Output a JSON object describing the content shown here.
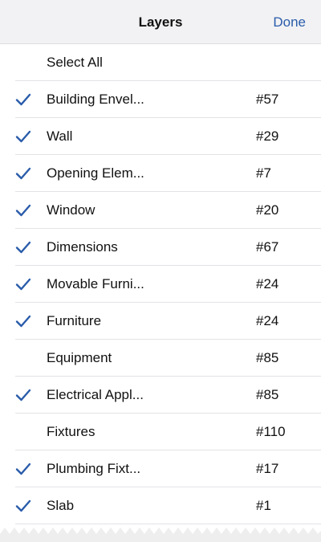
{
  "navbar": {
    "title": "Layers",
    "done_label": "Done"
  },
  "select_all_label": "Select All",
  "layers": [
    {
      "name": "Building Envel...",
      "count": "#57",
      "checked": true
    },
    {
      "name": "Wall",
      "count": "#29",
      "checked": true
    },
    {
      "name": "Opening Elem...",
      "count": "#7",
      "checked": true
    },
    {
      "name": "Window",
      "count": "#20",
      "checked": true
    },
    {
      "name": "Dimensions",
      "count": "#67",
      "checked": true
    },
    {
      "name": "Movable Furni...",
      "count": "#24",
      "checked": true
    },
    {
      "name": "Furniture",
      "count": "#24",
      "checked": true
    },
    {
      "name": "Equipment",
      "count": "#85",
      "checked": false
    },
    {
      "name": "Electrical Appl...",
      "count": "#85",
      "checked": true
    },
    {
      "name": "Fixtures",
      "count": "#110",
      "checked": false
    },
    {
      "name": "Plumbing Fixt...",
      "count": "#17",
      "checked": true
    },
    {
      "name": "Slab",
      "count": "#1",
      "checked": true
    }
  ],
  "icons": {
    "check": "checkmark-icon"
  },
  "colors": {
    "accent": "#2a5caa",
    "navbar_bg": "#f2f2f4",
    "separator": "#e3e3e6"
  }
}
